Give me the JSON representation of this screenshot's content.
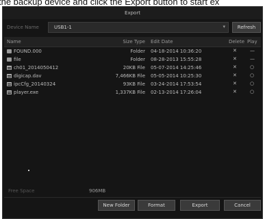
{
  "caption": {
    "text": "the backup device and click the Export button to start ex"
  },
  "dialog": {
    "title": "Export",
    "device_label": "Device Name",
    "device_value": "USB1-1",
    "refresh_label": "Refresh",
    "columns": {
      "name": "Name",
      "size": "Size Type",
      "date": "Edit Date",
      "delete": "Delete",
      "play": "Play"
    },
    "files": [
      {
        "name": "FOUND.000",
        "size": "Folder",
        "date": "04-18-2014 10:36:20",
        "type": "folder"
      },
      {
        "name": "file",
        "size": "Folder",
        "date": "08-28-2013 15:55:28",
        "type": "folder"
      },
      {
        "name": "ch01_2014050412",
        "size": "20KB File",
        "date": "05-07-2014 14:25:46",
        "type": "file"
      },
      {
        "name": "digicap.dav",
        "size": "7,466KB File",
        "date": "05-05-2014 10:25:30",
        "type": "file"
      },
      {
        "name": "ipcCfg_20140324",
        "size": "93KB File",
        "date": "03-24-2014 17:53:54",
        "type": "file"
      },
      {
        "name": "player.exe",
        "size": "1,337KB File",
        "date": "02-13-2014 17:26:04",
        "type": "file"
      }
    ],
    "free_label": "Free Space",
    "free_value": "906MB",
    "buttons": {
      "new_folder": "New Folder",
      "format": "Format",
      "export": "Export",
      "cancel": "Cancel"
    }
  }
}
